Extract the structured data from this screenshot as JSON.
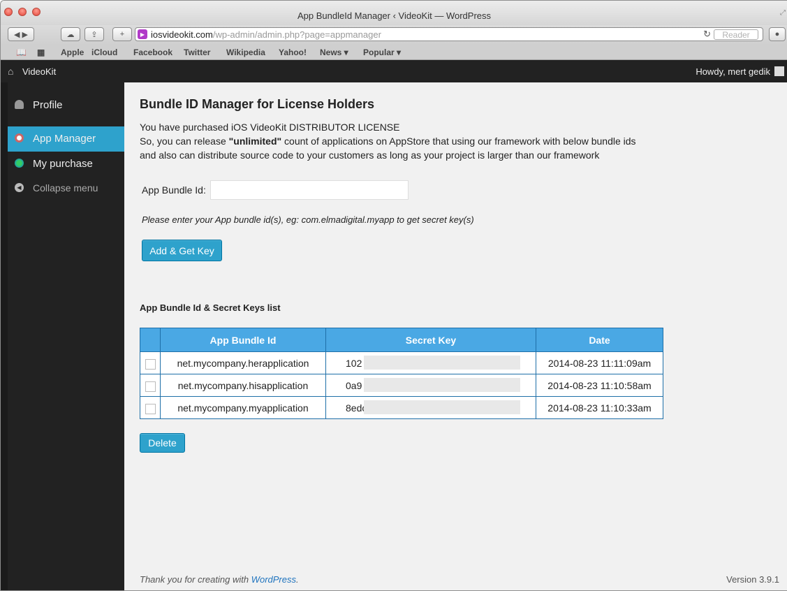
{
  "browser": {
    "title": "App BundleId Manager ‹ VideoKit — WordPress",
    "url_host": "iosvideokit.com",
    "url_path": "/wp-admin/admin.php?page=appmanager",
    "reader_label": "Reader",
    "bookmarks": [
      "Apple",
      "iCloud",
      "Facebook",
      "Twitter",
      "Wikipedia",
      "Yahoo!",
      "News ▾",
      "Popular ▾"
    ]
  },
  "adminbar": {
    "site_name": "VideoKit",
    "howdy": "Howdy, mert gedik"
  },
  "sidebar": {
    "items": [
      {
        "label": "Profile",
        "icon": "user-icon"
      },
      {
        "label": "App Manager",
        "icon": "app-icon",
        "active": true
      },
      {
        "label": "My purchase",
        "icon": "purchase-icon"
      },
      {
        "label": "Collapse menu",
        "icon": "collapse-icon"
      }
    ]
  },
  "main": {
    "title": "Bundle ID Manager for License Holders",
    "intro_line1": "You have purchased iOS VideoKit DISTRIBUTOR LICENSE",
    "intro_line2_pre": "So, you can release ",
    "intro_line2_bold": "\"unlimited\"",
    "intro_line2_post": " count of applications on AppStore that using our framework with below bundle ids",
    "intro_line3": "and also can distribute source code to your customers as long as your project is larger than our framework",
    "field_label": "App Bundle Id:",
    "field_value": "",
    "hint": "Please enter your App bundle id(s), eg: com.elmadigital.myapp to get secret key(s)",
    "add_button": "Add & Get Key",
    "list_title": "App Bundle Id & Secret Keys list",
    "columns": [
      "App Bundle Id",
      "Secret Key",
      "Date"
    ],
    "rows": [
      {
        "bundle": "net.mycompany.herapplication",
        "key": "102",
        "date": "2014-08-23 11:11:09am"
      },
      {
        "bundle": "net.mycompany.hisapplication",
        "key": "0a9",
        "date": "2014-08-23 11:10:58am"
      },
      {
        "bundle": "net.mycompany.myapplication",
        "key": "8edc",
        "date": "2014-08-23 11:10:33am"
      }
    ],
    "delete_button": "Delete",
    "footer_pre": "Thank you for creating with ",
    "footer_link": "WordPress",
    "footer_post": ".",
    "version": "Version 3.9.1"
  },
  "colors": {
    "accent": "#2ea2cc",
    "table_header": "#4aa8e4",
    "sidebar": "#222222"
  }
}
